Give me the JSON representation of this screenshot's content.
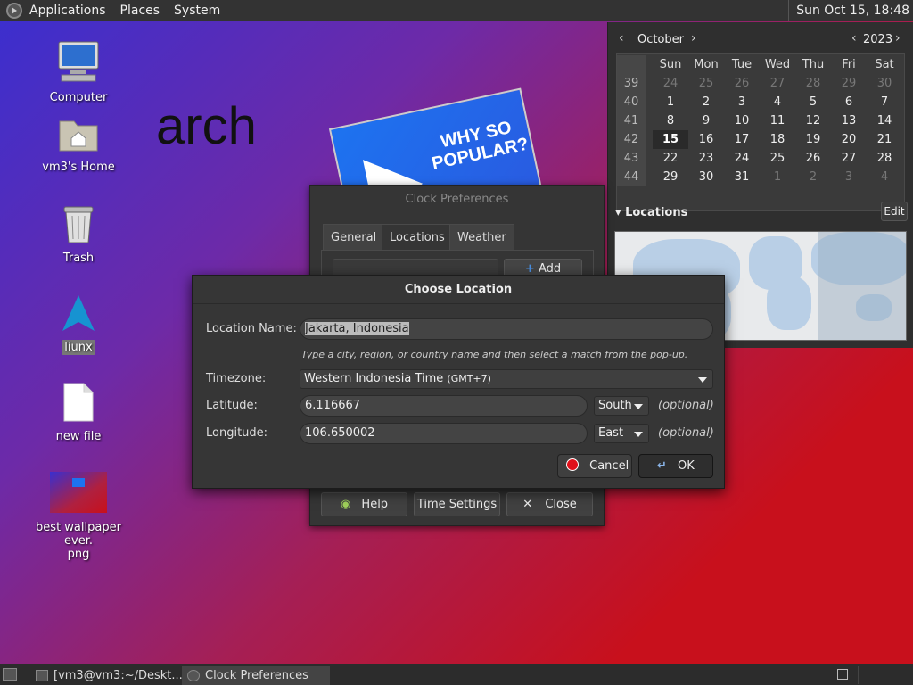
{
  "top_panel": {
    "menus": [
      "Applications",
      "Places",
      "System"
    ],
    "clock": "Sun Oct 15, 18:48"
  },
  "desktop": {
    "icons": [
      {
        "label": "Computer",
        "icon": "computer-icon"
      },
      {
        "label": "vm3's Home",
        "icon": "home-folder-icon"
      },
      {
        "label": "Trash",
        "icon": "trash-icon"
      },
      {
        "label": "liunx",
        "icon": "arch-logo-icon"
      },
      {
        "label": "new file",
        "icon": "file-icon"
      },
      {
        "label": "best wallpaper ever.\npng",
        "icon": "image-file-icon"
      }
    ],
    "wallpaper_text": "arch",
    "poster_text": "WHY SO POPULAR?"
  },
  "calendar": {
    "month": "October",
    "year": "2023",
    "weekday_headers": [
      "Sun",
      "Mon",
      "Tue",
      "Wed",
      "Thu",
      "Fri",
      "Sat"
    ],
    "weeks": [
      {
        "num": "39",
        "days": [
          "24",
          "25",
          "26",
          "27",
          "28",
          "29",
          "30"
        ]
      },
      {
        "num": "40",
        "days": [
          "1",
          "2",
          "3",
          "4",
          "5",
          "6",
          "7"
        ]
      },
      {
        "num": "41",
        "days": [
          "8",
          "9",
          "10",
          "11",
          "12",
          "13",
          "14"
        ]
      },
      {
        "num": "42",
        "days": [
          "15",
          "16",
          "17",
          "18",
          "19",
          "20",
          "21"
        ]
      },
      {
        "num": "43",
        "days": [
          "22",
          "23",
          "24",
          "25",
          "26",
          "27",
          "28"
        ]
      },
      {
        "num": "44",
        "days": [
          "29",
          "30",
          "31",
          "1",
          "2",
          "3",
          "4"
        ]
      }
    ],
    "today": "15",
    "locations_label": "Locations",
    "edit_label": "Edit"
  },
  "clock_prefs": {
    "title": "Clock Preferences",
    "tabs": [
      "General",
      "Locations",
      "Weather"
    ],
    "active_tab": "Locations",
    "add_label": "Add",
    "help_label": "Help",
    "time_settings_label": "Time Settings",
    "close_label": "Close"
  },
  "choose_location": {
    "title": "Choose Location",
    "location_name_label": "Location Name:",
    "location_name_value": "Jakarta, Indonesia",
    "hint": "Type a city, region, or country name and then select a match from the pop-up.",
    "timezone_label": "Timezone:",
    "timezone_value": "Western Indonesia Time",
    "timezone_offset": "(GMT+7)",
    "latitude_label": "Latitude:",
    "latitude_value": "6.116667",
    "latitude_dir": "South",
    "longitude_label": "Longitude:",
    "longitude_value": "106.650002",
    "longitude_dir": "East",
    "optional": "(optional)",
    "cancel_label": "Cancel",
    "ok_label": "OK"
  },
  "taskbar": {
    "tasks": [
      "[vm3@vm3:~/Deskt...",
      "Clock Preferences"
    ]
  }
}
